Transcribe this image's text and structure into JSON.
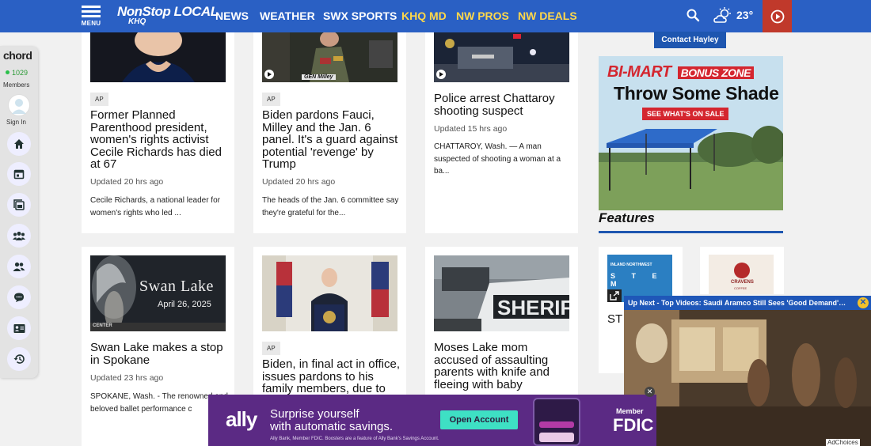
{
  "nav": {
    "menu_label": "MENU",
    "logo_line1": "NonStop LOCAL",
    "logo_line2": "KHQ",
    "links": [
      "NEWS",
      "WEATHER",
      "SWX SPORTS",
      "KHQ MD",
      "NW PROS",
      "NW DEALS"
    ],
    "temperature": "23°",
    "colors": {
      "nav_bg": "#2a60c4",
      "highlight": "#ffd84a",
      "live": "#c0392b"
    }
  },
  "sidebar": {
    "brand": "chord",
    "member_count": "1029",
    "members_label": "Members",
    "signin_label": "Sign In",
    "icons": [
      "home-icon",
      "calendar-icon",
      "events-icon",
      "groups-icon",
      "people-icon",
      "chat-icon",
      "contact-card-icon",
      "history-icon"
    ]
  },
  "articles": [
    {
      "tag": "AP",
      "title": "Former Planned Parenthood president, women's rights activist Cecile Richards has died at 67",
      "updated": "Updated 20 hrs ago",
      "summary": "Cecile Richards, a national leader for women's rights who led ..."
    },
    {
      "tag": "AP",
      "title": "Biden pardons Fauci, Milley and the Jan. 6 panel. It's a guard against potential 'revenge' by Trump",
      "updated": "Updated 20 hrs ago",
      "summary": "The heads of the Jan. 6 committee say they're grateful for the...",
      "caption": "GEN Milley"
    },
    {
      "title": "Police arrest Chattaroy shooting suspect",
      "updated": "Updated 15 hrs ago",
      "summary": "CHATTAROY, Wash. — A man suspected of shooting a woman at a ba..."
    },
    {
      "title": "Swan Lake makes a stop in Spokane",
      "updated": "Updated 23 hrs ago",
      "summary": "SPOKANE, Wash. - The renowned and beloved ballet performance c",
      "image_title": "Swan Lake",
      "image_date": "April 26, 2025",
      "image_small": "CENTER"
    },
    {
      "tag": "AP",
      "title": "Biden, in final act in office, issues pardons to his family members, due to"
    },
    {
      "title": "Moses Lake mom accused of assaulting parents with knife and fleeing with baby"
    }
  ],
  "right": {
    "contact_button": "Contact Hayley",
    "bimart": {
      "brand": "BI-MART",
      "zone": "BONUS ZONE",
      "headline": "Throw Some Shade",
      "cta": "SEE WHAT'S ON SALE"
    },
    "features_label": "Features",
    "feature_tiles": [
      {
        "lines": [
          "INLAND NORTHWEST",
          "S T E M"
        ],
        "label": "ST"
      },
      {
        "lines": [
          "CRAVENS",
          "COFFEE"
        ]
      }
    ]
  },
  "video": {
    "title": "Up Next - Top Videos: Saudi Aramco Still Sees 'Good Demand'…"
  },
  "ad": {
    "brand": "ally",
    "headline": "Surprise yourself",
    "subheadline": "with automatic savings.",
    "fine_print": "Ally Bank, Member FDIC. Boosters are a feature of Ally Bank's Savings Account.",
    "button": "Open Account",
    "member_label": "Member",
    "fdic_label": "FDIC",
    "adchoices": "AdChoices"
  }
}
